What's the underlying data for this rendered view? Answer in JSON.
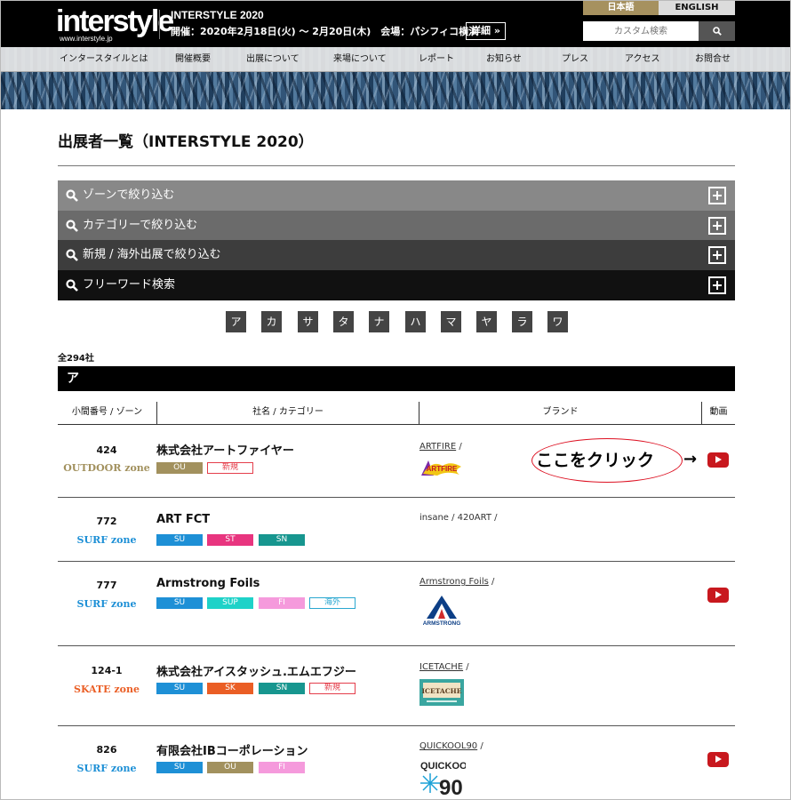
{
  "header": {
    "logo_text": "interstyle",
    "logo_url": "www.interstyle.jp",
    "event_title": "INTERSTYLE 2020",
    "event_info": "開催：2020年2月18日(火) 〜 2月20日(木)　会場：パシフィコ横浜",
    "detail_label": "詳細 »",
    "lang_ja": "日本語",
    "lang_en": "ENGLISH",
    "search_placeholder": "カスタム検索",
    "search_button": "🔍"
  },
  "nav": [
    "インタースタイルとは",
    "開催概要",
    "出展について",
    "来場について",
    "レポート",
    "お知らせ",
    "プレス",
    "アクセス",
    "お問合せ"
  ],
  "page_title": "出展者一覧（INTERSTYLE 2020）",
  "filters": [
    "ゾーンで絞り込む",
    "カテゴリーで絞り込む",
    "新規 / 海外出展で絞り込む",
    "フリーワード検索"
  ],
  "kana": [
    "ア",
    "カ",
    "サ",
    "タ",
    "ナ",
    "ハ",
    "マ",
    "ヤ",
    "ラ",
    "ワ"
  ],
  "total": "全294社",
  "section": "ア",
  "table_headers": [
    "小間番号 / ゾーン",
    "社名 / カテゴリー",
    "ブランド",
    "動画"
  ],
  "rows": [
    {
      "booth": "424",
      "zone": "OUTDOOR zone",
      "company": "株式会社アートファイヤー",
      "tags": [
        "OU",
        "新規"
      ],
      "brands": "ARTFIRE",
      "logo": "ARTFIRE"
    },
    {
      "booth": "772",
      "zone": "SURF zone",
      "company": "ART FCT",
      "tags": [
        "SU",
        "ST",
        "SN"
      ],
      "brands": "insane / 420ART /"
    },
    {
      "booth": "777",
      "zone": "SURF zone",
      "company": "Armstrong Foils",
      "tags": [
        "SU",
        "SUP",
        "FI",
        "海外"
      ],
      "brands": "Armstrong Foils",
      "logo": "ARMSTRONG"
    },
    {
      "booth": "124-1",
      "zone": "SKATE zone",
      "company": "株式会社アイスタッシュ.エムエフジー",
      "tags": [
        "SU",
        "SK",
        "SN",
        "新規"
      ],
      "brands": "ICETACHE",
      "logo": "ICETACHE"
    },
    {
      "booth": "826",
      "zone": "SURF zone",
      "company": "有限会社IBコーポレーション",
      "tags": [
        "SU",
        "OU",
        "FI"
      ],
      "brands": "QUICKOOL90",
      "logo": "QUICKOOL"
    }
  ],
  "callout": "ここをクリック",
  "callout_arrow": "→",
  "colors": {
    "outdoor": "#a2915e",
    "surf": "#1e90d6",
    "skate": "#ea5e25",
    "st": "#e8357f",
    "sn": "#17968f",
    "sup": "#1ed2c8",
    "fi": "#f59adc",
    "new": "#e43e4b",
    "kaigai": "#2aa7d0"
  }
}
